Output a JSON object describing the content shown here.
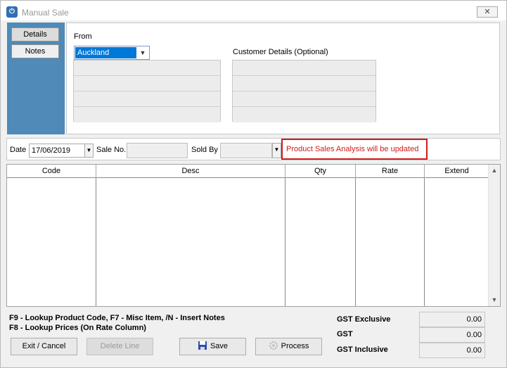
{
  "window": {
    "title": "Manual Sale",
    "close_glyph": "✕"
  },
  "tabs": [
    {
      "label": "Details",
      "active": true
    },
    {
      "label": "Notes",
      "active": false
    }
  ],
  "details": {
    "from_label": "From",
    "from_value": "Auckland",
    "customer_label": "Customer Details (Optional)"
  },
  "date_row": {
    "date_label": "Date",
    "date_value": "17/06/2019",
    "sale_no_label": "Sale No.",
    "sold_by_label": "Sold By",
    "notice": "Product Sales Analysis will be updated"
  },
  "items": {
    "columns": [
      "Code",
      "Desc",
      "Qty",
      "Rate",
      "Extend"
    ]
  },
  "footer": {
    "keys_line1": "F9 - Lookup Product Code,      F7 - Misc Item,      /N - Insert Notes",
    "keys_line2": "F8 - Lookup Prices (On Rate Column)",
    "buttons": {
      "exit": "Exit / Cancel",
      "delete": "Delete Line",
      "save": "Save",
      "process": "Process"
    },
    "gst": {
      "exclusive_label": "GST Exclusive",
      "exclusive_value": "0.00",
      "gst_label": "GST",
      "gst_value": "0.00",
      "inclusive_label": "GST Inclusive",
      "inclusive_value": "0.00"
    }
  },
  "colors": {
    "tab_strip": "#4f8ab8",
    "selection": "#0078d7",
    "notice": "#d11a1a"
  },
  "icons": [
    "app-icon",
    "close-icon",
    "chevron-down-icon",
    "save-icon",
    "process-icon",
    "scroll-up-icon",
    "scroll-down-icon"
  ]
}
